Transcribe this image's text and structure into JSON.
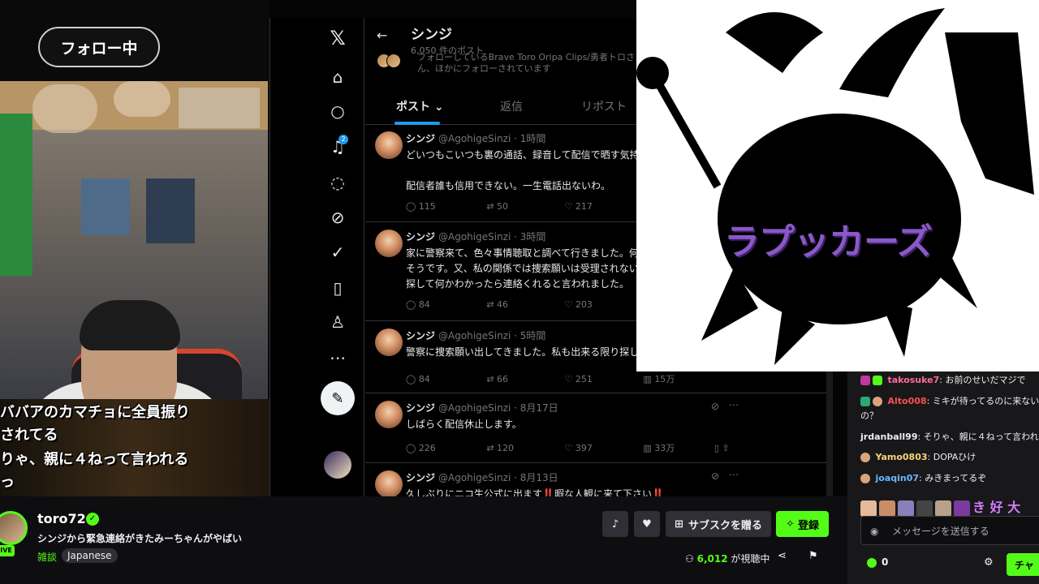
{
  "stream": {
    "follow_label": "フォロー中",
    "subtitles": [
      "ババアのカマチョに全員振り",
      "されてる",
      "りゃ、親に４ねって言われる",
      "っ"
    ]
  },
  "x": {
    "profile_name": "シンジ",
    "post_count": "6,050 件のポスト",
    "follow_note": "フォローしているBrave Toro Oripa Clips/勇者トロさん、ほかにフォローされています",
    "tabs": [
      "ポスト",
      "返信",
      "リポスト"
    ],
    "notification_count": "2",
    "tweets": [
      {
        "name": "シンジ",
        "handle": "@AgohigeSinzi · 1時間",
        "body": "どいつもこいつも裏の通話、録音して配信で晒す気持\n\n配信者誰も信用できない。一生電話出ないわ。",
        "replies": "115",
        "reposts": "50",
        "likes": "217",
        "views": ""
      },
      {
        "name": "シンジ",
        "handle": "@AgohigeSinzi · 3時間",
        "body": "家に警察来て、色々事情聴取と調べて行きました。何\nそうです。又、私の関係では捜索願いは受理されない\n探して何かわかったら連絡くれると言われました。",
        "replies": "84",
        "reposts": "46",
        "likes": "203",
        "views": ""
      },
      {
        "name": "シンジ",
        "handle": "@AgohigeSinzi · 5時間",
        "body": "警察に捜索願い出してきました。私も出来る限り探し",
        "replies": "84",
        "reposts": "66",
        "likes": "251",
        "views": "15万"
      },
      {
        "name": "シンジ",
        "handle": "@AgohigeSinzi · 8月17日",
        "body": "しばらく配信休止します。",
        "replies": "226",
        "reposts": "120",
        "likes": "397",
        "views": "33万"
      },
      {
        "name": "シンジ",
        "handle": "@AgohigeSinzi · 8月13日",
        "body": "久しぶりにニコ生公式に出ます‼️暇な人観に来て下さい‼️",
        "replies": "",
        "reposts": "",
        "likes": "",
        "views": ""
      }
    ]
  },
  "art": {
    "title": "ラプッカーズ"
  },
  "chat": {
    "messages": [
      {
        "user": "takosuke7",
        "text": ": お前のせいだマジで",
        "color": "#ff6b9b"
      },
      {
        "user": "Alto008",
        "text": ": ミキが待ってるのに来ない",
        "color": "#ff4f4f"
      },
      {
        "user": "",
        "text": "の？",
        "color": "#efeff1"
      },
      {
        "user": "jrdanball99",
        "text": ": そりゃ、親に４ねって言われ",
        "color": "#efeff1"
      },
      {
        "user": "Yamo0803",
        "text": ": DOPAひけ",
        "color": "#ffd27a"
      },
      {
        "user": "joaqin07",
        "text": ": みきまってるぞ",
        "color": "#6bb6ff"
      }
    ],
    "emote_text": "き 好 大",
    "input_placeholder": "メッセージを送信する",
    "points": "0",
    "send_label": "チャ"
  },
  "channel": {
    "name": "toro72",
    "title": "シンジから緊急連絡がきたみーちゃんがやばい",
    "category": "雑談",
    "language": "Japanese",
    "live_label": "LIVE",
    "viewers": "6,012",
    "viewers_suffix": " が視聴中",
    "subscribe_gift_label": "サブスクを贈る",
    "subscribe_label": "登録"
  }
}
